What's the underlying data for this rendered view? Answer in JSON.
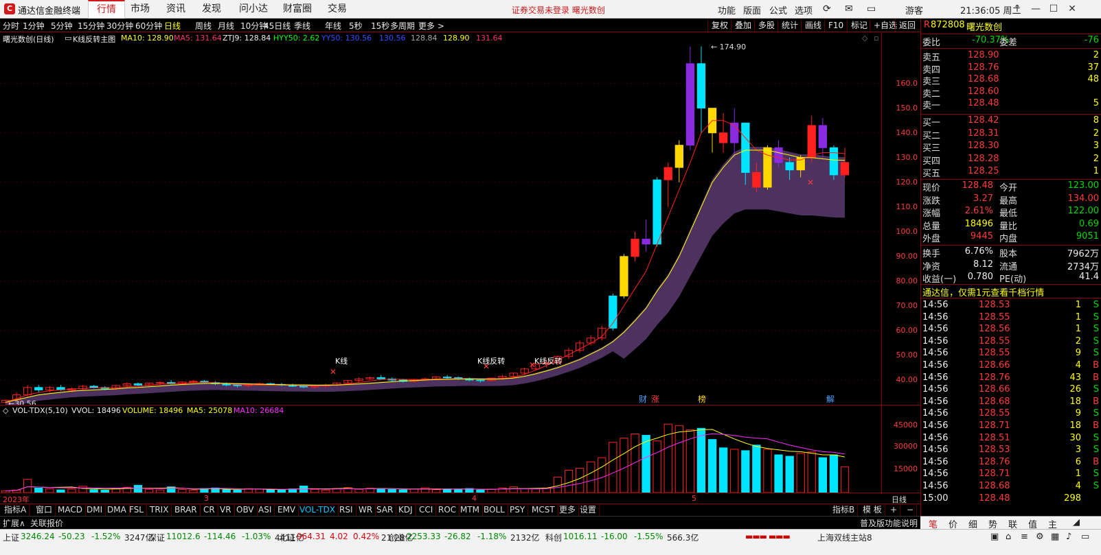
{
  "app": {
    "title": "通达信金融终端",
    "menu": [
      "行情",
      "市场",
      "资讯",
      "发现",
      "问小达",
      "财富圈",
      "交易"
    ],
    "active_menu": "行情",
    "notice": "证券交易未登录  曙光数创",
    "right_menu": [
      "功能",
      "版面",
      "公式",
      "选项"
    ],
    "guest": "游客",
    "clock": "21:36:05 周二"
  },
  "periods": [
    "分时",
    "1分钟",
    "5分钟",
    "15分钟",
    "30分钟",
    "60分钟",
    "日线",
    "周线",
    "月线",
    "10分钟",
    "45日线",
    "季线",
    "年线",
    "5秒",
    "15秒",
    "多周期",
    "更多 >"
  ],
  "active_period": "日线",
  "tools": [
    "复权",
    "叠加",
    "多股",
    "统计",
    "画线",
    "F10",
    "标记",
    "+自选",
    "返回"
  ],
  "main_header": {
    "name": "曙光数创(日线)",
    "indicator": "K线反转主图",
    "ma10": "MA10: 128.90",
    "ma5": "MA5: 131.64",
    "ztj": "ZTJ9: 128.84",
    "hyy": "HYY50: 2.62",
    "yy": "YY50: 130.56",
    "tail1": "130.56",
    "tail2": "128.84",
    "tail3": "128.90",
    "tail4": "131.64"
  },
  "price_axis": [
    "160.0",
    "150.0",
    "140.0",
    "130.0",
    "120.0",
    "110.0",
    "100.0",
    "90.00",
    "80.00",
    "70.00",
    "60.00",
    "50.00",
    "40.00"
  ],
  "annotations": {
    "high": "174.90",
    "low": "30.56",
    "kline_reversal": "K线反转",
    "kline_short": "K线",
    "tags": [
      "财",
      "涨",
      "榜",
      "解"
    ]
  },
  "vol_header": {
    "name": "VOL-TDX(5,10)",
    "vvol": "VVOL: 18496",
    "volume": "VOLUME: 18496",
    "ma5": "MA5: 25078",
    "ma10": "MA10: 26684"
  },
  "vol_axis": [
    "45000",
    "30000",
    "15000"
  ],
  "date_axis": [
    "2023年",
    "3",
    "4",
    "5"
  ],
  "date_axis_right": "日线",
  "indicator_tabs": [
    "指标A",
    "窗口",
    "MACD",
    "DMI",
    "DMA",
    "FSL",
    "TRIX",
    "BRAR",
    "CR",
    "VR",
    "OBV",
    "ASI",
    "EMV",
    "VOL-TDX",
    "RSI",
    "WR",
    "SAR",
    "KDJ",
    "CCI",
    "ROC",
    "MTM",
    "BOLL",
    "PSY",
    "MCST",
    "更多",
    "设置"
  ],
  "active_indicator": "VOL-TDX",
  "indicator_tabs_right": [
    "指标B",
    "模 板",
    "+",
    "−"
  ],
  "ext_bar": [
    "扩展∧",
    "关联报价"
  ],
  "ext_bar_right": "普及版功能说明",
  "status": [
    {
      "name": "上证",
      "val": "3246.24",
      "chg": "-50.23",
      "pct": "-1.52%",
      "amt": "3247亿"
    },
    {
      "name": "深证",
      "val": "11012.6",
      "chg": "-114.46",
      "pct": "-1.03%",
      "amt": "4411亿"
    },
    {
      "name": "北证",
      "val": "964.31",
      "chg": "4.02",
      "pct": "0.42%",
      "amt": "21.28亿"
    },
    {
      "name": "创业",
      "val": "2253.33",
      "chg": "-26.82",
      "pct": "-1.18%",
      "amt": "2132亿"
    },
    {
      "name": "科创",
      "val": "1016.11",
      "chg": "-16.00",
      "pct": "-1.55%",
      "amt": "566.3亿"
    }
  ],
  "status_server": "上海双线主站8",
  "stock": {
    "code": "872808",
    "name": "曙光数创",
    "flag": "R"
  },
  "weibi": {
    "label": "委比",
    "value": "-70.37%",
    "label2": "委差",
    "value2": "-76"
  },
  "asks": [
    {
      "label": "卖五",
      "price": "128.90",
      "vol": "2"
    },
    {
      "label": "卖四",
      "price": "128.76",
      "vol": "37"
    },
    {
      "label": "卖三",
      "price": "128.68",
      "vol": "48"
    },
    {
      "label": "卖二",
      "price": "128.60",
      "vol": ""
    },
    {
      "label": "卖一",
      "price": "128.48",
      "vol": "5"
    }
  ],
  "bids": [
    {
      "label": "买一",
      "price": "128.42",
      "vol": "8"
    },
    {
      "label": "买二",
      "price": "128.31",
      "vol": "2"
    },
    {
      "label": "买三",
      "price": "128.30",
      "vol": "3"
    },
    {
      "label": "买四",
      "price": "128.28",
      "vol": "2"
    },
    {
      "label": "买五",
      "price": "128.25",
      "vol": "1"
    }
  ],
  "quote": [
    {
      "l1": "现价",
      "v1": "128.48",
      "c1": "red",
      "l2": "今开",
      "v2": "123.00",
      "c2": "grn"
    },
    {
      "l1": "涨跌",
      "v1": "3.27",
      "c1": "red",
      "l2": "最高",
      "v2": "134.00",
      "c2": "red"
    },
    {
      "l1": "涨幅",
      "v1": "2.61%",
      "c1": "red",
      "l2": "最低",
      "v2": "122.00",
      "c2": "grn"
    },
    {
      "l1": "总量",
      "v1": "18496",
      "c1": "yel",
      "l2": "量比",
      "v2": "0.69",
      "c2": "grn"
    },
    {
      "l1": "外盘",
      "v1": "9445",
      "c1": "red",
      "l2": "内盘",
      "v2": "9051",
      "c2": "grn"
    }
  ],
  "fundamentals": [
    {
      "l1": "换手",
      "v1": "6.76%",
      "l2": "股本",
      "v2": "7962万"
    },
    {
      "l1": "净资",
      "v1": "8.12",
      "l2": "流通",
      "v2": "2734万"
    },
    {
      "l1": "收益(一)",
      "v1": "0.780",
      "l2": "PE(动)",
      "v2": "41.4"
    }
  ],
  "ad": "通达信，仅需1元查看千档行情",
  "ticks": [
    {
      "t": "14:56",
      "p": "128.53",
      "v": "1",
      "s": "S"
    },
    {
      "t": "14:56",
      "p": "128.55",
      "v": "1",
      "s": "S"
    },
    {
      "t": "14:56",
      "p": "128.56",
      "v": "1",
      "s": "S"
    },
    {
      "t": "14:56",
      "p": "128.55",
      "v": "2",
      "s": "S"
    },
    {
      "t": "14:56",
      "p": "128.55",
      "v": "9",
      "s": "S"
    },
    {
      "t": "14:56",
      "p": "128.66",
      "v": "4",
      "s": "B"
    },
    {
      "t": "14:56",
      "p": "128.76",
      "v": "43",
      "s": "B"
    },
    {
      "t": "14:56",
      "p": "128.66",
      "v": "26",
      "s": "S"
    },
    {
      "t": "14:56",
      "p": "128.68",
      "v": "18",
      "s": "B"
    },
    {
      "t": "14:56",
      "p": "128.55",
      "v": "9",
      "s": "S"
    },
    {
      "t": "14:56",
      "p": "128.71",
      "v": "18",
      "s": "B"
    },
    {
      "t": "14:56",
      "p": "128.51",
      "v": "30",
      "s": "S"
    },
    {
      "t": "14:56",
      "p": "128.53",
      "v": "3",
      "s": "S"
    },
    {
      "t": "14:56",
      "p": "128.76",
      "v": "6",
      "s": "B"
    },
    {
      "t": "14:56",
      "p": "128.71",
      "v": "1",
      "s": "S"
    },
    {
      "t": "14:56",
      "p": "128.68",
      "v": "4",
      "s": "S"
    },
    {
      "t": "15:00",
      "p": "128.48",
      "v": "298",
      "s": ""
    }
  ],
  "right_tabs": [
    "笔",
    "价",
    "细",
    "势",
    "联",
    "值",
    "主"
  ],
  "chart_data": {
    "type": "candlestick",
    "ylim": [
      30,
      176
    ],
    "candles": [
      [
        31,
        32,
        30.6,
        31.8
      ],
      [
        32,
        35,
        31.5,
        34
      ],
      [
        34,
        38,
        33,
        37
      ],
      [
        37,
        38,
        35,
        36
      ],
      [
        36,
        37.5,
        35,
        37
      ],
      [
        37,
        38,
        35.5,
        36
      ],
      [
        36,
        37,
        35,
        36.5
      ],
      [
        36.5,
        38,
        36,
        37.5
      ],
      [
        37.5,
        38,
        36.5,
        37
      ],
      [
        37,
        37.5,
        36,
        36.5
      ],
      [
        36.5,
        38,
        36,
        37.8
      ],
      [
        37.8,
        39,
        37,
        38.5
      ],
      [
        38.5,
        39,
        37.5,
        38
      ],
      [
        38,
        39,
        37.5,
        38.8
      ],
      [
        38.8,
        39.5,
        38,
        39
      ],
      [
        39,
        40,
        38,
        38.5
      ],
      [
        38.5,
        39.5,
        38,
        39.2
      ],
      [
        39.2,
        40,
        38.5,
        39.5
      ],
      [
        39.5,
        40,
        38.8,
        39
      ],
      [
        39,
        39.5,
        38,
        38.5
      ],
      [
        38.5,
        39,
        37.5,
        38
      ],
      [
        38,
        38.5,
        37,
        37.8
      ],
      [
        37.8,
        38.5,
        37,
        38.2
      ],
      [
        38.2,
        39,
        37.8,
        38.5
      ],
      [
        38.5,
        39,
        38,
        38.2
      ],
      [
        38.2,
        38.8,
        37.5,
        38
      ],
      [
        38,
        38.5,
        37.2,
        37.5
      ],
      [
        37.5,
        38,
        36.8,
        37.2
      ],
      [
        37.2,
        38,
        36.5,
        37.6
      ],
      [
        37.6,
        38.5,
        37,
        38
      ],
      [
        38,
        39,
        37.5,
        38.8
      ],
      [
        38.8,
        40,
        38.5,
        39.8
      ],
      [
        39.8,
        41,
        39,
        40.5
      ],
      [
        40.5,
        41.5,
        40,
        41
      ],
      [
        41,
        42,
        40.2,
        40.5
      ],
      [
        40.5,
        41,
        39.5,
        40
      ],
      [
        40,
        40.5,
        39,
        39.5
      ],
      [
        39.5,
        40.5,
        39,
        40.2
      ],
      [
        40.2,
        41,
        39.8,
        40.5
      ],
      [
        40.5,
        41.5,
        40,
        41.2
      ],
      [
        41.2,
        42,
        40.5,
        41
      ],
      [
        41,
        41.5,
        40,
        40.5
      ],
      [
        40.5,
        41,
        39.5,
        40
      ],
      [
        40,
        40.5,
        39,
        39.8
      ],
      [
        39.8,
        41,
        39.5,
        40.8
      ],
      [
        40.8,
        42,
        40.5,
        41.5
      ],
      [
        41.5,
        43,
        41,
        42.8
      ],
      [
        42.8,
        45,
        42,
        44.5
      ],
      [
        44.5,
        47,
        44,
        46.5
      ],
      [
        46.5,
        48,
        45,
        47
      ],
      [
        47,
        50,
        46,
        49.5
      ],
      [
        49.5,
        53,
        48.5,
        52
      ],
      [
        52,
        56,
        51,
        55
      ],
      [
        55,
        58,
        54,
        57
      ],
      [
        57,
        62,
        56,
        61
      ],
      [
        61,
        75,
        60,
        74
      ],
      [
        74,
        91,
        73,
        90
      ],
      [
        90,
        100,
        88,
        97
      ],
      [
        97,
        105,
        92,
        95
      ],
      [
        95,
        122,
        94,
        121
      ],
      [
        121,
        128,
        110,
        126
      ],
      [
        126,
        137,
        120,
        135
      ],
      [
        135,
        175,
        133,
        168
      ],
      [
        168,
        175,
        140,
        150
      ],
      [
        150,
        142,
        132,
        140
      ],
      [
        140,
        148,
        132,
        136
      ],
      [
        136,
        150,
        130,
        144
      ],
      [
        144,
        136,
        119,
        124
      ],
      [
        124,
        128,
        116,
        118
      ],
      [
        118,
        135,
        117,
        134
      ],
      [
        134,
        137,
        126,
        128
      ],
      [
        128,
        130,
        121,
        125
      ],
      [
        125,
        131,
        122,
        130
      ],
      [
        130,
        147,
        128,
        143
      ],
      [
        143,
        146,
        130,
        134
      ],
      [
        134,
        135,
        121,
        123
      ],
      [
        123,
        134,
        122,
        128
      ]
    ],
    "series": [
      {
        "name": "MA5",
        "values": [
          31,
          32.5,
          34,
          35,
          35.6,
          36,
          36.3,
          36.6,
          36.8,
          36.8,
          37,
          37.3,
          37.6,
          37.9,
          38.3,
          38.5,
          38.7,
          39,
          39.1,
          38.9,
          38.6,
          38.2,
          38,
          38,
          38,
          38,
          37.9,
          37.7,
          37.6,
          37.7,
          38,
          38.4,
          39,
          39.6,
          40.2,
          40.4,
          40.3,
          40.2,
          40.1,
          40.3,
          40.5,
          40.6,
          40.5,
          40.3,
          40.2,
          40.5,
          41.1,
          42.3,
          44,
          45.9,
          48,
          50.3,
          52.6,
          54.9,
          57.6,
          63,
          70,
          77,
          84,
          95,
          106,
          117,
          128,
          140,
          145,
          145,
          143,
          138,
          133,
          131,
          130,
          129,
          129,
          131,
          132,
          132,
          131.6
        ]
      },
      {
        "name": "MA10",
        "values": [
          31,
          32,
          33,
          34,
          34.5,
          35,
          35.5,
          35.8,
          36,
          36.2,
          36.4,
          36.8,
          37,
          37.3,
          37.6,
          37.9,
          38.2,
          38.4,
          38.6,
          38.7,
          38.6,
          38.5,
          38.4,
          38.3,
          38.2,
          38.1,
          38,
          38,
          37.9,
          37.9,
          38,
          38.2,
          38.4,
          38.7,
          39,
          39.3,
          39.6,
          39.8,
          40,
          40.2,
          40.3,
          40.4,
          40.5,
          40.4,
          40.4,
          40.5,
          40.8,
          41.5,
          42.5,
          43.7,
          45,
          46.6,
          48.3,
          50.5,
          52.7,
          55.5,
          59.3,
          64,
          69,
          76,
          82,
          90,
          100,
          110,
          120,
          126,
          131,
          133,
          133,
          133,
          132,
          131,
          130,
          130,
          129.5,
          129,
          128.9
        ]
      }
    ],
    "volumes": [
      1200,
      1800,
      9500,
      3200,
      2800,
      1900,
      2400,
      4500,
      2100,
      1700,
      2600,
      3800,
      5200,
      2300,
      1900,
      4100,
      2200,
      1800,
      2900,
      3300,
      2100,
      1700,
      2800,
      2500,
      1900,
      2200,
      2600,
      4700,
      2300,
      1800,
      2900,
      3600,
      2400,
      3100,
      2800,
      2200,
      1900,
      2600,
      3400,
      2100,
      2500,
      2200,
      2900,
      1800,
      2400,
      3200,
      4100,
      2800,
      2600,
      3300,
      11000,
      16000,
      17500,
      22000,
      25000,
      36000,
      39000,
      42000,
      41000,
      37000,
      49000,
      48000,
      45000,
      46000,
      38000,
      32000,
      31000,
      30000,
      34000,
      31000,
      27000,
      26000,
      28000,
      29000,
      25000,
      27000,
      18496
    ]
  }
}
